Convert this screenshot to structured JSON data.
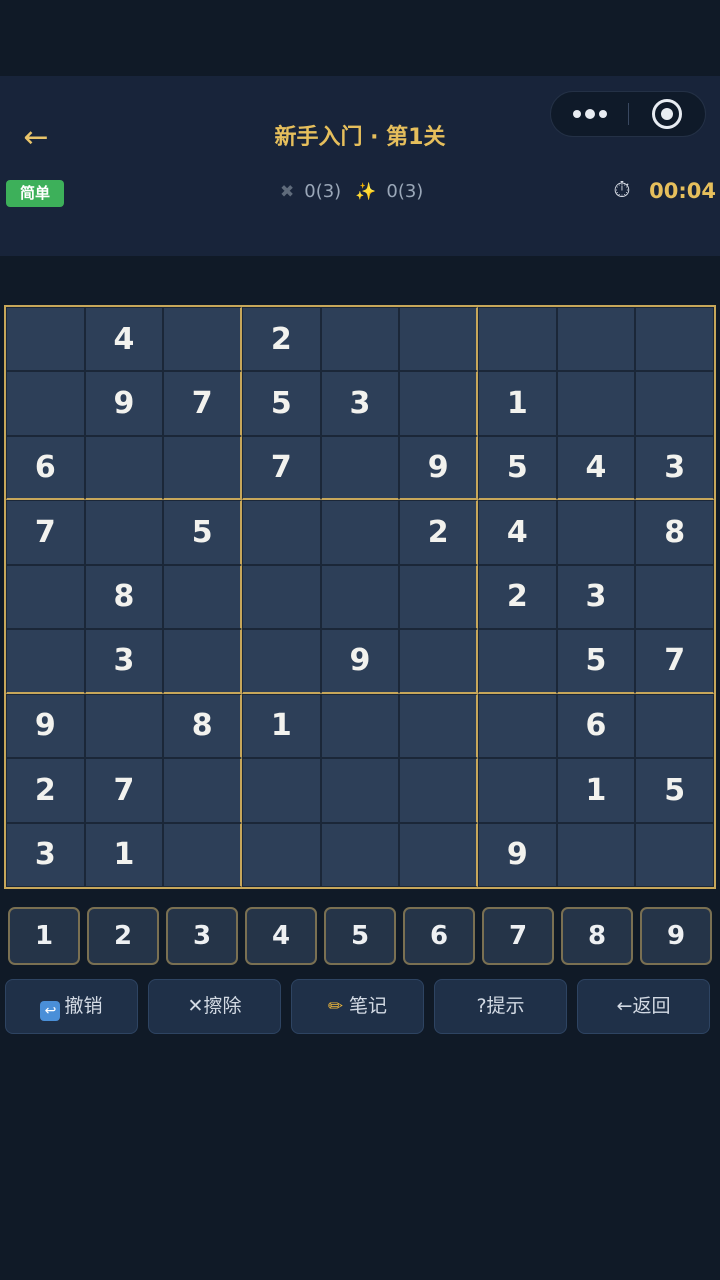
{
  "header": {
    "back_icon": "←",
    "title": "新手入门 · 第1关",
    "more_icon": "more-dots-icon",
    "target_icon": "target-icon"
  },
  "status": {
    "difficulty": "简单",
    "mistakes_icon": "✖",
    "mistakes": "0(3)",
    "hints_icon": "✨",
    "hints": "0(3)",
    "timer_icon": "⏱",
    "timer": "00:04"
  },
  "board": {
    "grid": [
      [
        "",
        "4",
        "",
        "2",
        "",
        "",
        "",
        "",
        ""
      ],
      [
        "",
        "9",
        "7",
        "5",
        "3",
        "",
        "1",
        "",
        ""
      ],
      [
        "6",
        "",
        "",
        "7",
        "",
        "9",
        "5",
        "4",
        "3"
      ],
      [
        "7",
        "",
        "5",
        "",
        "",
        "2",
        "4",
        "",
        "8"
      ],
      [
        "",
        "8",
        "",
        "",
        "",
        "",
        "2",
        "3",
        ""
      ],
      [
        "",
        "3",
        "",
        "",
        "9",
        "",
        "",
        "5",
        "7"
      ],
      [
        "9",
        "",
        "8",
        "1",
        "",
        "",
        "",
        "6",
        ""
      ],
      [
        "2",
        "7",
        "",
        "",
        "",
        "",
        "",
        "1",
        "5"
      ],
      [
        "3",
        "1",
        "",
        "",
        "",
        "",
        "9",
        "",
        ""
      ]
    ]
  },
  "numpad": [
    "1",
    "2",
    "3",
    "4",
    "5",
    "6",
    "7",
    "8",
    "9"
  ],
  "actions": {
    "undo_icon": "↩",
    "undo": "撤销",
    "erase": "✕擦除",
    "notes_icon": "✏",
    "notes": "笔记",
    "hint": "?提示",
    "return": "←返回"
  },
  "colors": {
    "accent_gold": "#e6bf5c",
    "badge_green": "#3db05a",
    "cell_bg": "#2d3f58",
    "page_bg": "#101a27"
  }
}
